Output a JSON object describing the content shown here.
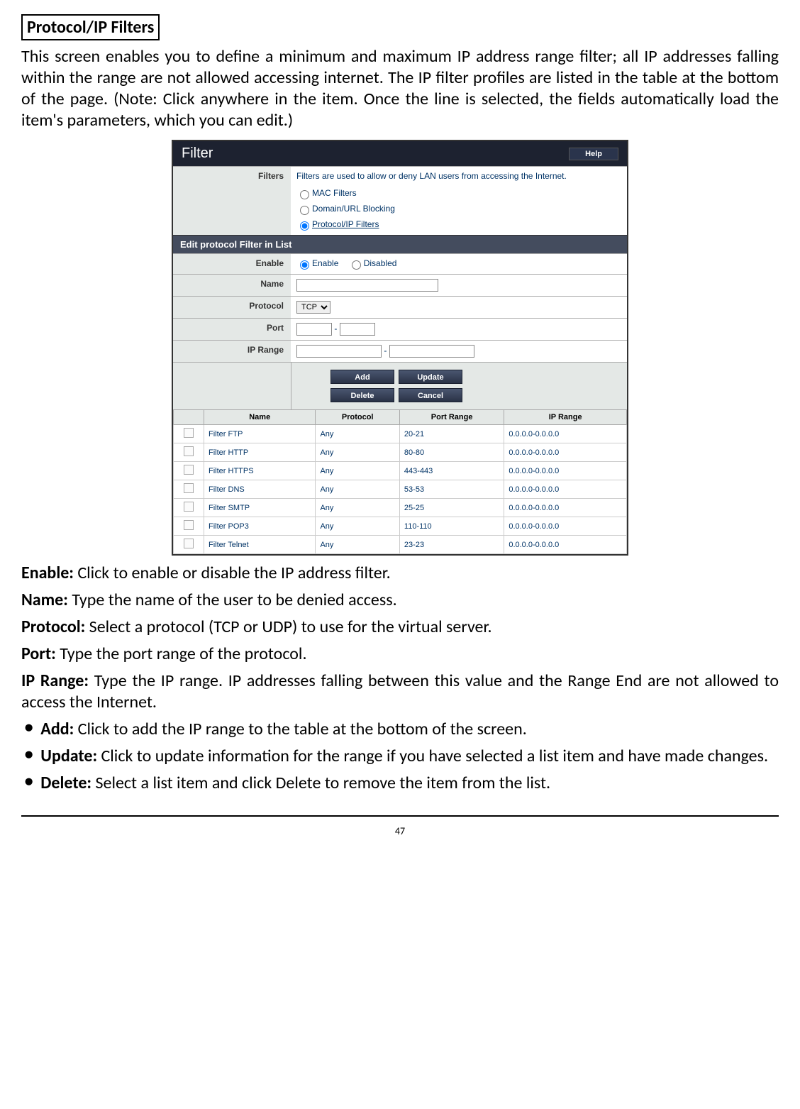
{
  "doc": {
    "title": "Protocol/IP Filters",
    "intro": "This screen enables you to define a minimum and maximum IP address range filter; all IP addresses falling within the range are not allowed accessing internet. The IP filter profiles are listed in the table at the bottom of the page. (Note: Click anywhere in the item. Once the line is selected, the fields automatically load the item's parameters, which you can edit.)",
    "page_number": "47"
  },
  "ui": {
    "panel_title": "Filter",
    "help_label": "Help",
    "filters_label": "Filters",
    "filters_desc": "Filters are used to allow or deny LAN users from accessing the Internet.",
    "filter_options": {
      "mac": "MAC Filters",
      "url": "Domain/URL Blocking",
      "ip": "Protocol/IP Filters"
    },
    "edit_header": "Edit protocol Filter in List",
    "labels": {
      "enable": "Enable",
      "name": "Name",
      "protocol": "Protocol",
      "port": "Port",
      "iprange": "IP Range"
    },
    "enable_options": {
      "enable": "Enable",
      "disabled": "Disabled"
    },
    "protocol_value": "TCP",
    "buttons": {
      "add": "Add",
      "update": "Update",
      "delete": "Delete",
      "cancel": "Cancel"
    },
    "table": {
      "headers": {
        "name": "Name",
        "protocol": "Protocol",
        "port": "Port Range",
        "ip": "IP Range"
      },
      "rows": [
        {
          "name": "Filter FTP",
          "protocol": "Any",
          "port": "20-21",
          "ip": "0.0.0.0-0.0.0.0"
        },
        {
          "name": "Filter HTTP",
          "protocol": "Any",
          "port": "80-80",
          "ip": "0.0.0.0-0.0.0.0"
        },
        {
          "name": "Filter HTTPS",
          "protocol": "Any",
          "port": "443-443",
          "ip": "0.0.0.0-0.0.0.0"
        },
        {
          "name": "Filter DNS",
          "protocol": "Any",
          "port": "53-53",
          "ip": "0.0.0.0-0.0.0.0"
        },
        {
          "name": "Filter SMTP",
          "protocol": "Any",
          "port": "25-25",
          "ip": "0.0.0.0-0.0.0.0"
        },
        {
          "name": "Filter POP3",
          "protocol": "Any",
          "port": "110-110",
          "ip": "0.0.0.0-0.0.0.0"
        },
        {
          "name": "Filter Telnet",
          "protocol": "Any",
          "port": "23-23",
          "ip": "0.0.0.0-0.0.0.0"
        }
      ]
    }
  },
  "defs": {
    "enable": {
      "label": "Enable:",
      "text": " Click to enable or disable the IP address filter."
    },
    "name": {
      "label": "Name:",
      "text": " Type the name of the user to be denied access."
    },
    "protocol": {
      "label": "Protocol:",
      "text": " Select a protocol (TCP or UDP) to use for the virtual server."
    },
    "port": {
      "label": "Port:",
      "text": " Type the port range of the protocol."
    },
    "iprange": {
      "label": "IP Range:",
      "text": " Type the IP range. IP addresses falling between this value and the Range End are not allowed to access the Internet."
    }
  },
  "bullets": {
    "add": {
      "label": "Add:",
      "text": " Click to add the IP range to the table at the bottom of the screen."
    },
    "update": {
      "label": "Update:",
      "text": " Click to update information for the range if you have selected a list item and have made changes."
    },
    "delete": {
      "label": "Delete:",
      "text": " Select a list item and click Delete to remove the item from the list."
    }
  }
}
